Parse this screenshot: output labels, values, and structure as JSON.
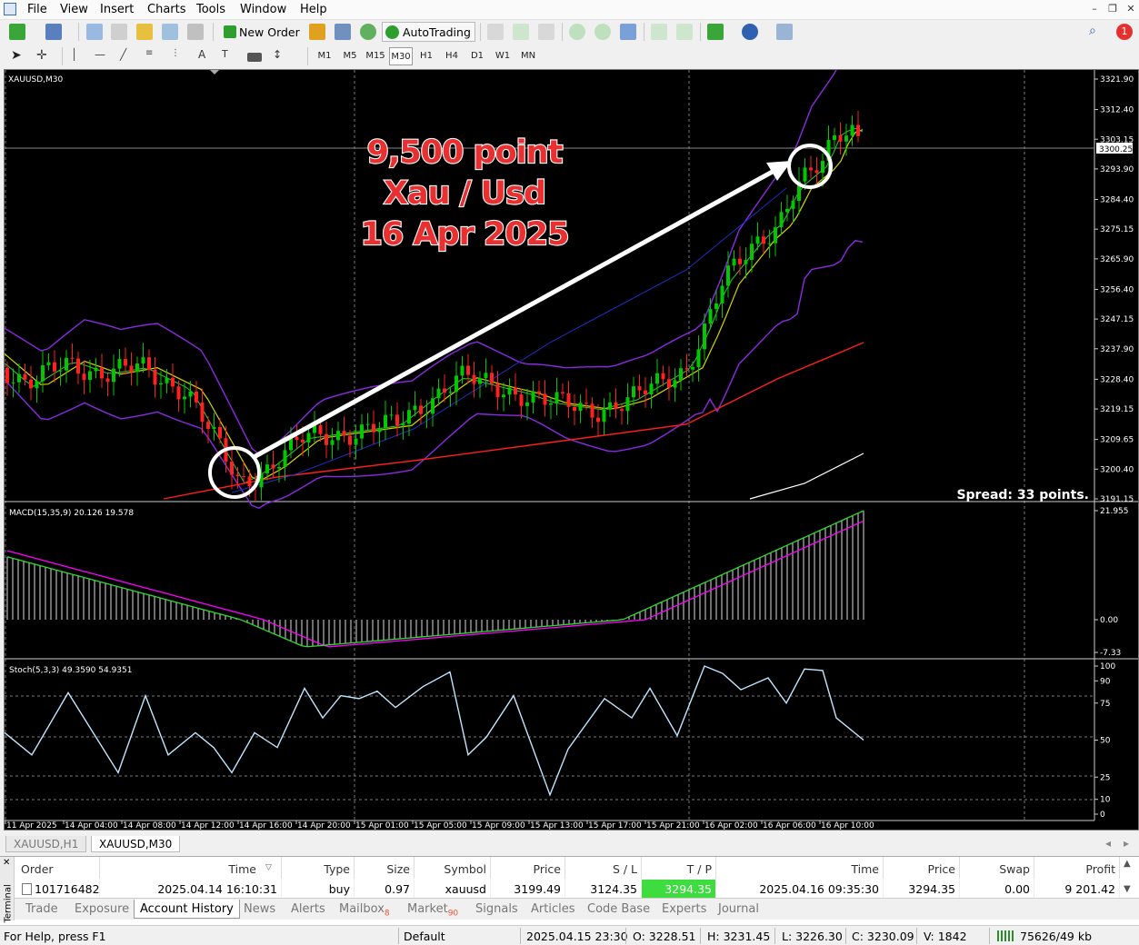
{
  "menu": {
    "items": [
      "File",
      "View",
      "Insert",
      "Charts",
      "Tools",
      "Window",
      "Help"
    ]
  },
  "toolbar": {
    "new_order": "New Order",
    "autotrading": "AutoTrading",
    "timeframes": [
      "M1",
      "M5",
      "M15",
      "M30",
      "H1",
      "H4",
      "D1",
      "W1",
      "MN"
    ],
    "active_timeframe": "M30"
  },
  "notification_count": "1",
  "chart": {
    "symbol_label": "XAUUSD,M30",
    "annotation": [
      "9,500 point",
      "Xau / Usd",
      "16 Apr 2025"
    ],
    "spread_text": "Spread: 33 points.",
    "current_price": "3300.25",
    "price_ticks": [
      "3321.90",
      "3312.40",
      "3303.15",
      "3293.90",
      "3284.40",
      "3275.15",
      "3265.90",
      "3256.40",
      "3247.15",
      "3237.90",
      "3228.40",
      "3219.15",
      "3209.65",
      "3200.40",
      "3191.15"
    ],
    "macd_label": "MACD(15,35,9) 20.126 19.578",
    "macd_ticks": [
      "21.955",
      "0.00",
      "-7.33"
    ],
    "stoch_label": "Stoch(5,3,3) 49.3590 54.9351",
    "stoch_ticks": [
      "100",
      "90",
      "75",
      "50",
      "25",
      "10",
      "0"
    ],
    "time_ticks": [
      "11 Apr 2025",
      "14 Apr 04:00",
      "14 Apr 08:00",
      "14 Apr 12:00",
      "14 Apr 16:00",
      "14 Apr 20:00",
      "15 Apr 01:00",
      "15 Apr 05:00",
      "15 Apr 09:00",
      "15 Apr 13:00",
      "15 Apr 17:00",
      "15 Apr 21:00",
      "16 Apr 02:00",
      "16 Apr 06:00",
      "16 Apr 10:00"
    ],
    "colors": {
      "bull": "#00c800",
      "bear": "#ff2020",
      "bollinger": "#8a2be2",
      "ma_yellow": "#d4d400",
      "ma_red": "#ff1e1e",
      "stoch": "#bfe6ff",
      "macd_signal": "#ff00ff",
      "macd_main": "#2fd92f",
      "annot": "#e83030"
    }
  },
  "chart_tabs": [
    "XAUUSD,H1",
    "XAUUSD,M30"
  ],
  "active_chart_tab": "XAUUSD,M30",
  "terminal": {
    "side_label": "Terminal",
    "headers": [
      "Order",
      "Time",
      "Type",
      "Size",
      "Symbol",
      "Price",
      "S / L",
      "T / P",
      "Time",
      "Price",
      "Swap",
      "Profit"
    ],
    "row": [
      "101716482",
      "2025.04.14 16:10:31",
      "buy",
      "0.97",
      "xauusd",
      "3199.49",
      "3124.35",
      "3294.35",
      "2025.04.16 09:35:30",
      "3294.35",
      "0.00",
      "9 201.42"
    ],
    "tabs": [
      "Trade",
      "Exposure",
      "Account History",
      "News",
      "Alerts",
      "Mailbox",
      "Market",
      "Signals",
      "Articles",
      "Code Base",
      "Experts",
      "Journal"
    ],
    "mailbox_count": "8",
    "market_count": "90",
    "active_tab": "Account History"
  },
  "status": {
    "help": "For Help, press F1",
    "profile": "Default",
    "datetime": "2025.04.15 23:30",
    "open": "O: 3228.51",
    "high": "H: 3231.45",
    "low": "L: 3226.30",
    "close": "C: 3230.09",
    "volume": "V: 1842",
    "traffic": "75626/49 kb"
  }
}
